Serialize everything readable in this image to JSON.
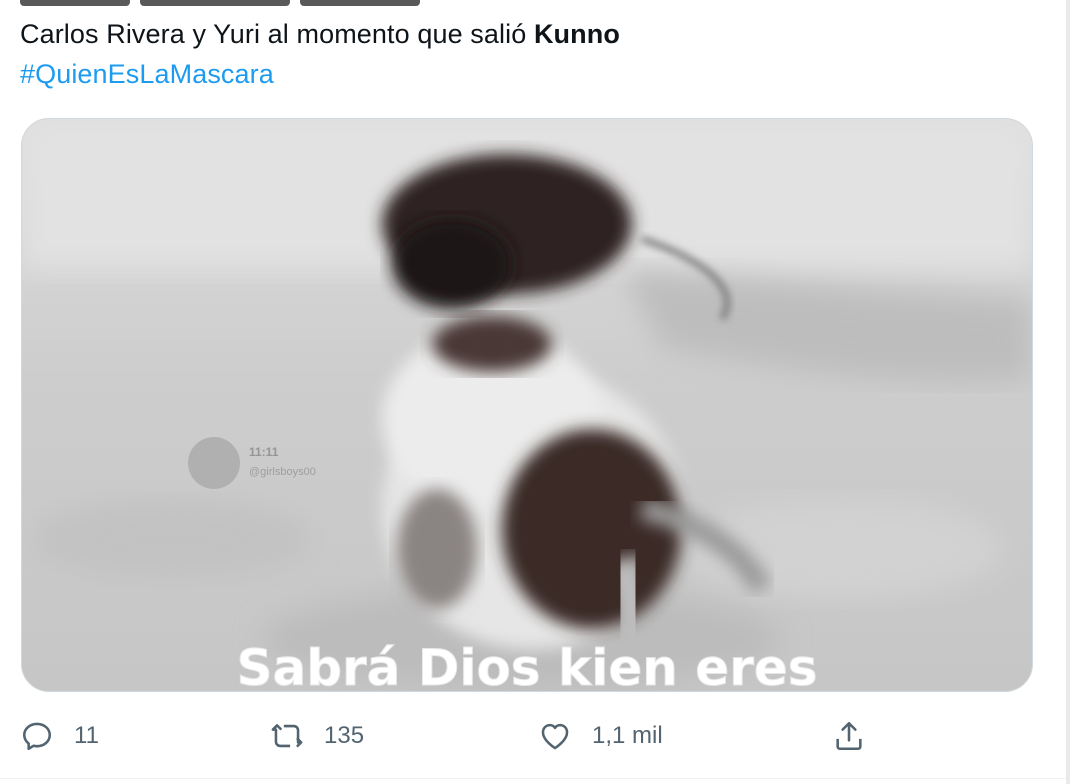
{
  "tweet": {
    "text_prefix": "Carlos Rivera y Yuri al momento que salió ",
    "text_bold": "Kunno",
    "hashtag": "#QuienEsLaMascara"
  },
  "media": {
    "caption": "Sabrá Dios kien eres",
    "watermark_time": "11:11",
    "watermark_handle": "@girlsboys00"
  },
  "actions": {
    "reply_count": "11",
    "retweet_count": "135",
    "like_count": "1,1 mil"
  },
  "icons": {
    "reply": "reply-icon",
    "retweet": "retweet-icon",
    "like": "heart-icon",
    "share": "share-icon"
  },
  "colors": {
    "link": "#1d9bf0",
    "action": "#536471"
  }
}
